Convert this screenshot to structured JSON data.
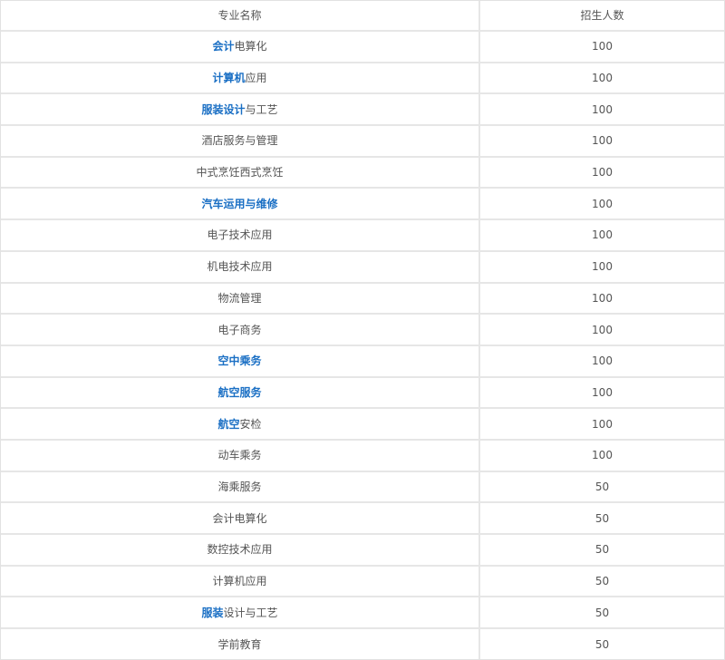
{
  "table": {
    "headers": [
      "专业名称",
      "招生人数"
    ],
    "rows": [
      {
        "name_link": "会计",
        "name_rest": "电算化",
        "count": "100"
      },
      {
        "name_link": "计算机",
        "name_rest": "应用",
        "count": "100"
      },
      {
        "name_link": "服装设计",
        "name_rest": "与工艺",
        "count": "100"
      },
      {
        "name_link": "",
        "name_rest": "酒店服务与管理",
        "count": "100"
      },
      {
        "name_link": "",
        "name_rest": "中式烹饪西式烹饪",
        "count": "100"
      },
      {
        "name_link": "汽车运用与维修",
        "name_rest": "",
        "count": "100"
      },
      {
        "name_link": "",
        "name_rest": "电子技术应用",
        "count": "100"
      },
      {
        "name_link": "",
        "name_rest": "机电技术应用",
        "count": "100"
      },
      {
        "name_link": "",
        "name_rest": "物流管理",
        "count": "100"
      },
      {
        "name_link": "",
        "name_rest": "电子商务",
        "count": "100"
      },
      {
        "name_link": "空中乘务",
        "name_rest": "",
        "count": "100"
      },
      {
        "name_link": "航空服务",
        "name_rest": "",
        "count": "100"
      },
      {
        "name_link": "航空",
        "name_rest": "安检",
        "count": "100"
      },
      {
        "name_link": "",
        "name_rest": "动车乘务",
        "count": "100"
      },
      {
        "name_link": "",
        "name_rest": "海乘服务",
        "count": "50"
      },
      {
        "name_link": "",
        "name_rest": "会计电算化",
        "count": "50"
      },
      {
        "name_link": "",
        "name_rest": "数控技术应用",
        "count": "50"
      },
      {
        "name_link": "",
        "name_rest": "计算机应用",
        "count": "50"
      },
      {
        "name_link": "服装",
        "name_rest": "设计与工艺",
        "count": "50"
      },
      {
        "name_link": "",
        "name_rest": "学前教育",
        "count": "50"
      }
    ]
  },
  "colors": {
    "link": "#1a6fc4",
    "text": "#555555",
    "grid": "#e6e6e6"
  }
}
